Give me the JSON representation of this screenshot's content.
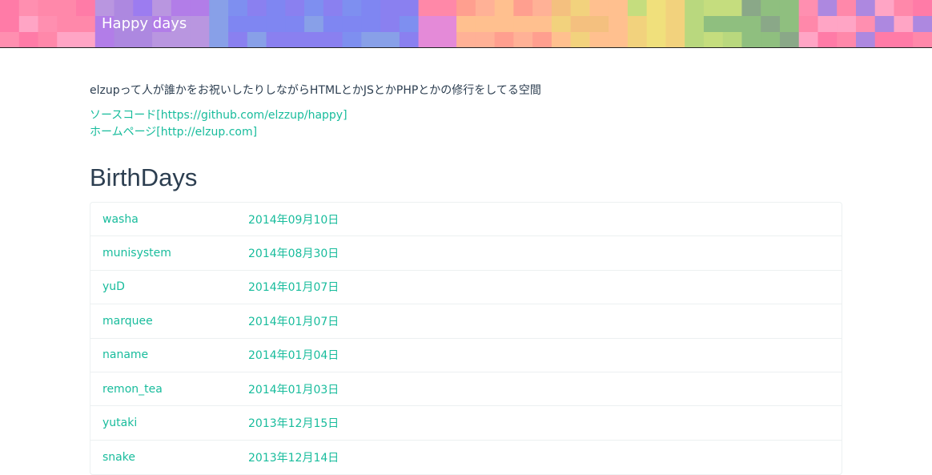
{
  "navbar": {
    "brand": "Happy days"
  },
  "intro": {
    "description": "elzupって人が誰かをお祝いしたりしながらHTMLとかJSとかPHPとかの修行をしてる空間",
    "links": [
      {
        "label": "ソースコード[https://github.com/elzzup/happy]"
      },
      {
        "label": "ホームページ[http://elzup.com]"
      }
    ]
  },
  "birthdays": {
    "title": "BirthDays",
    "items": [
      {
        "name": "washa",
        "date": "2014年09月10日"
      },
      {
        "name": "munisystem",
        "date": "2014年08月30日"
      },
      {
        "name": "yuD",
        "date": "2014年01月07日"
      },
      {
        "name": "marquee",
        "date": "2014年01月07日"
      },
      {
        "name": "naname",
        "date": "2014年01月04日"
      },
      {
        "name": "remon_tea",
        "date": "2014年01月03日"
      },
      {
        "name": "yutaki",
        "date": "2013年12月15日"
      },
      {
        "name": "snake",
        "date": "2013年12月14日"
      }
    ]
  },
  "colors": {
    "accent": "#18bc9c",
    "text": "#2c3e50",
    "pixel_palette": [
      "#ff88aa",
      "#ff7ba7",
      "#ad88e0",
      "#b27de8",
      "#9c7cf0",
      "#8a80f0",
      "#7f86f2",
      "#7e8ff0",
      "#88a0e8",
      "#e48ad8",
      "#ff88a8",
      "#ff9f8f",
      "#ffb196",
      "#ffc08f",
      "#f4c07f",
      "#f2d27d",
      "#f0e07c",
      "#c5dd7e",
      "#b9d87e",
      "#8fbf7f",
      "#8aa888",
      "#ff8fb0",
      "#ff8a9c",
      "#ffa5c5",
      "#b996e0"
    ]
  }
}
